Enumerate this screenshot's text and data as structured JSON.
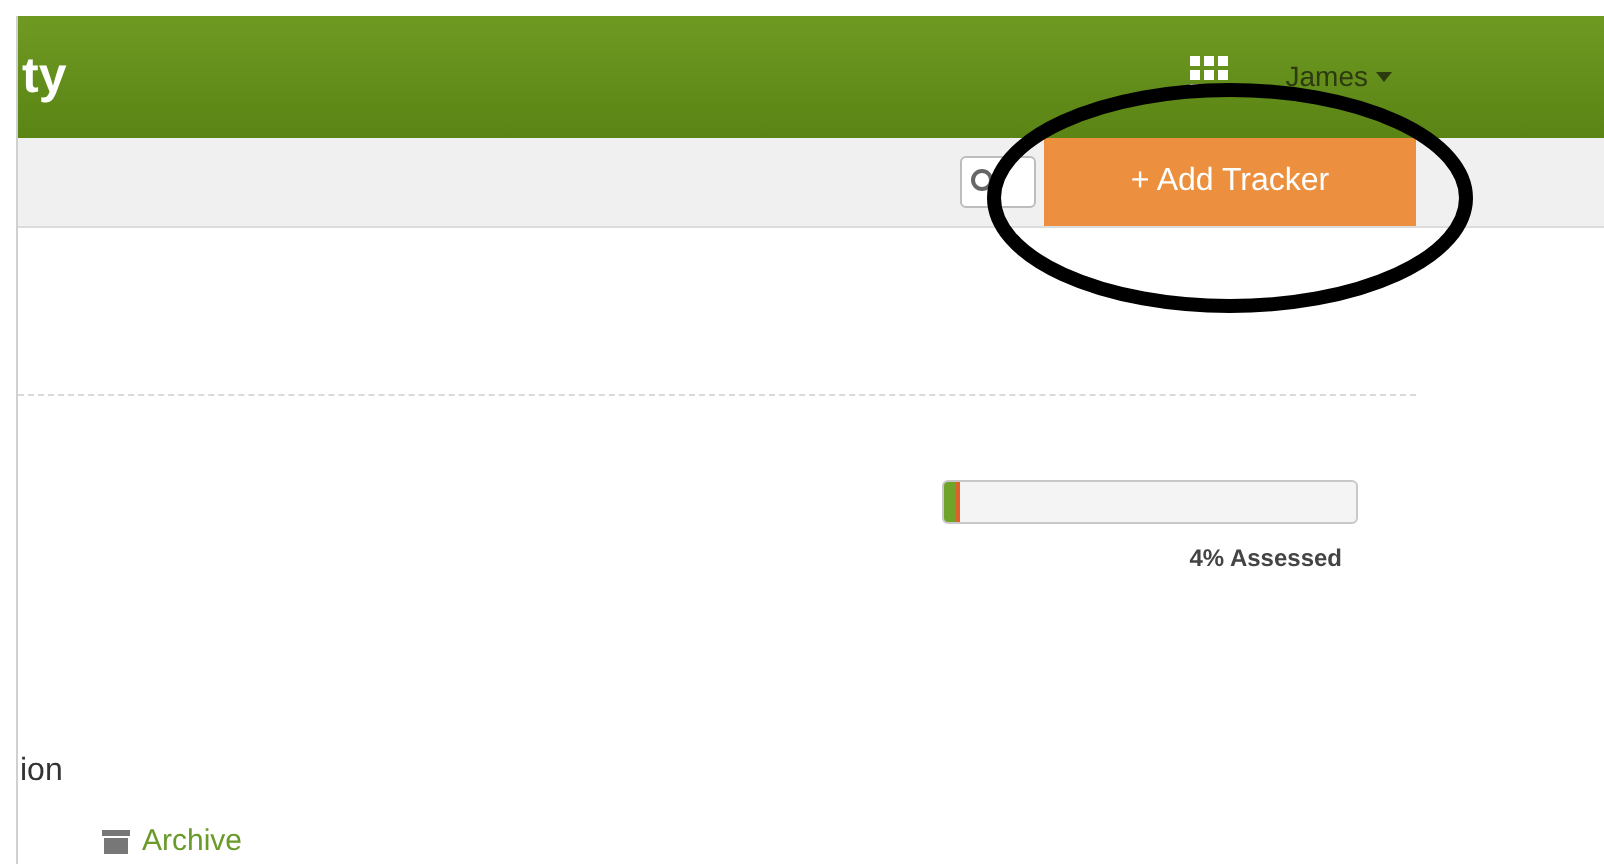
{
  "header": {
    "title": "ty",
    "user": "James"
  },
  "toolbar": {
    "button": "+ Add Tracker"
  },
  "progress": {
    "level": 0.04,
    "reading": "4% Assessed"
  },
  "section": {
    "title": "ion"
  },
  "links": [
    {
      "label": "Archive"
    }
  ]
}
